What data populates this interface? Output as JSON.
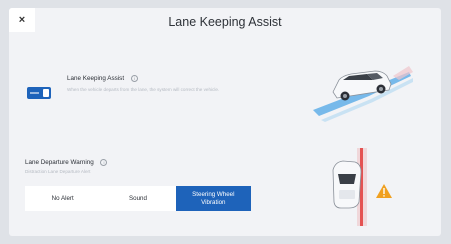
{
  "header": {
    "close_label": "×",
    "title": "Lane Keeping Assist"
  },
  "lane_keeping": {
    "label": "Lane Keeping Assist",
    "info_label": "i",
    "description": "When the vehicle departs from the lane, the system will correct the vehicle.",
    "enabled": true
  },
  "lane_departure": {
    "label": "Lane Departure Warning",
    "info_label": "i",
    "subtitle": "Distraction Lane Departure Alert",
    "options": [
      "No Alert",
      "Sound",
      "Steering Wheel Vibration"
    ],
    "selected": "Steering Wheel Vibration"
  },
  "colors": {
    "accent": "#1e63ba",
    "warning": "#f0a020",
    "lane_highlight": "#4ea6e6",
    "alert_red": "#e23a3a"
  }
}
